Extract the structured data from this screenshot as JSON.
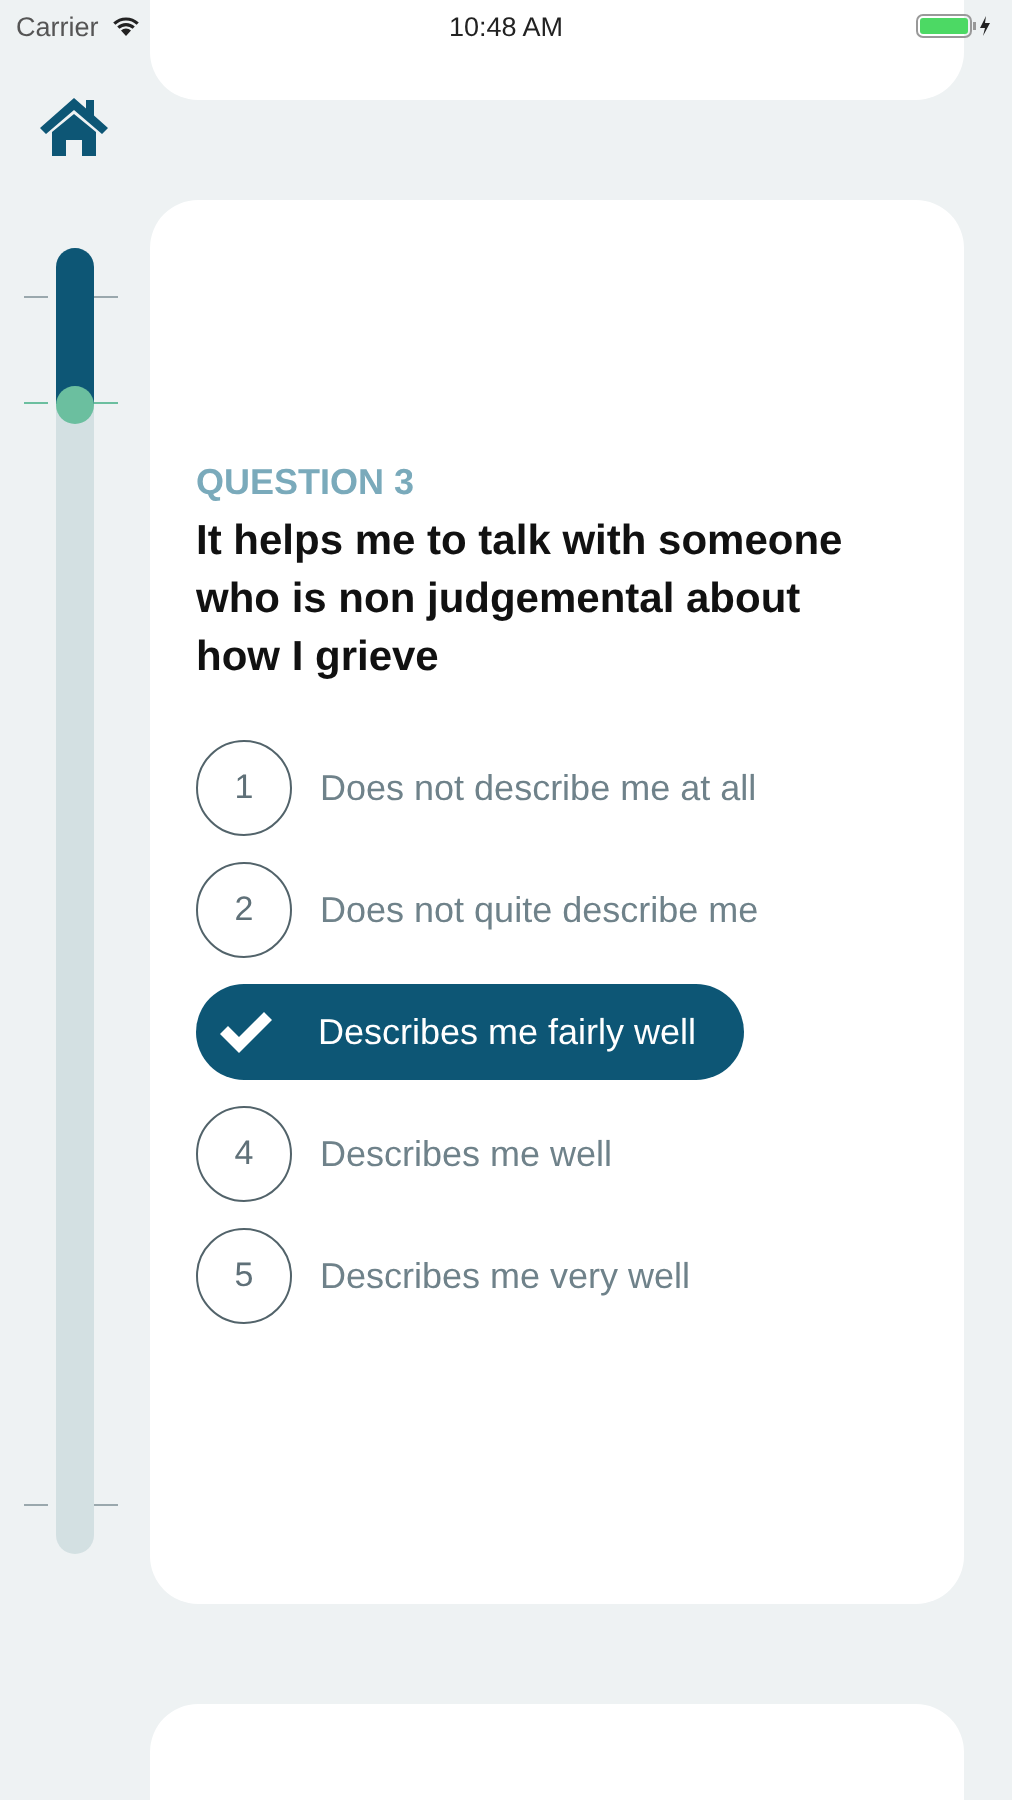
{
  "status_bar": {
    "carrier": "Carrier",
    "time": "10:48 AM"
  },
  "progress": {
    "level": 0.12
  },
  "question": {
    "label": "QUESTION 3",
    "text": "It helps me to talk with someone who is non judgemental about how I grieve"
  },
  "options": [
    {
      "number": "1",
      "label": "Does not describe me at all",
      "selected": false
    },
    {
      "number": "2",
      "label": "Does not quite describe me",
      "selected": false
    },
    {
      "label": "Describes me fairly well",
      "selected": true
    },
    {
      "number": "4",
      "label": "Describes me well",
      "selected": false
    },
    {
      "number": "5",
      "label": "Describes me very well",
      "selected": false
    }
  ]
}
